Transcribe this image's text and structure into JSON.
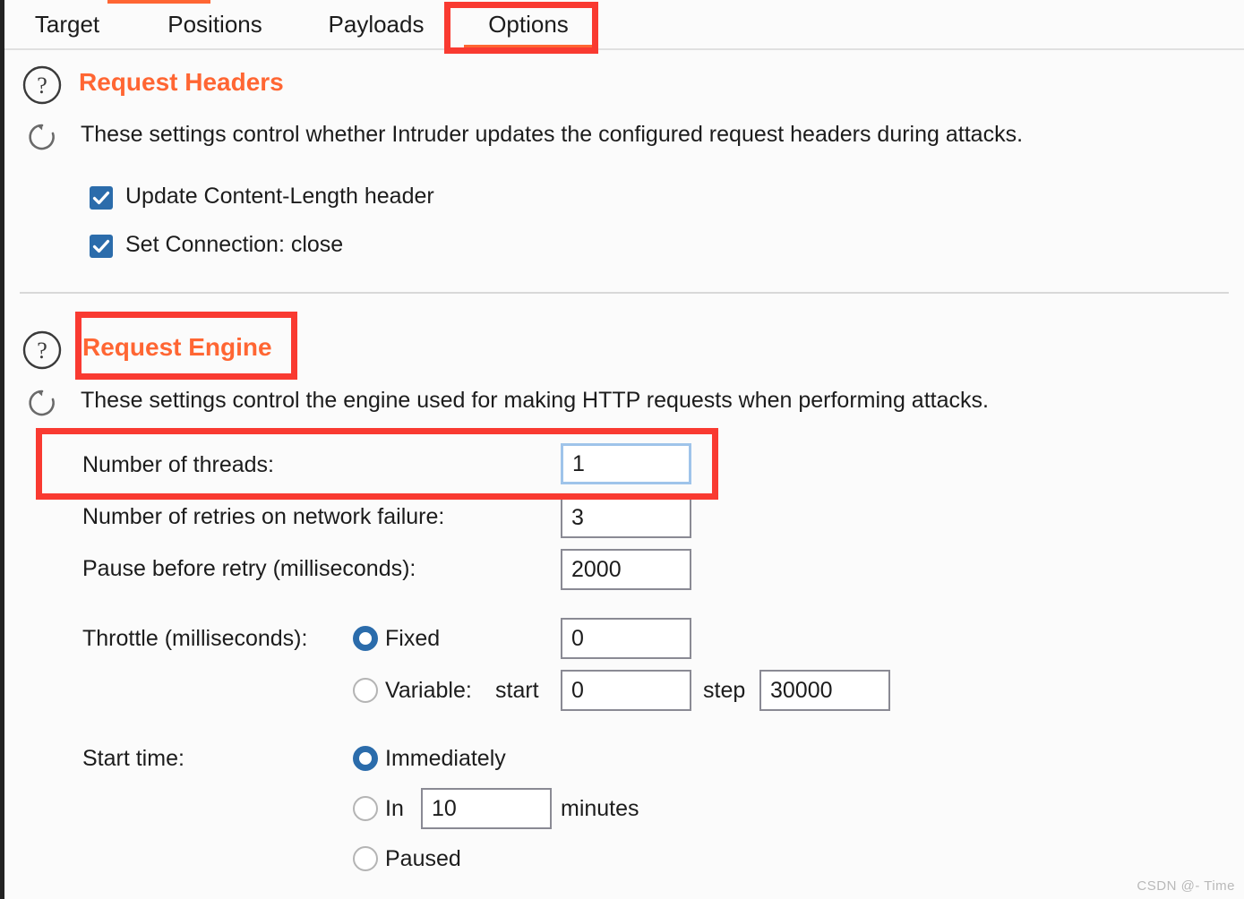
{
  "window": {
    "accent_orange": "#ff6633",
    "annotation_red": "#f93a31",
    "control_blue": "#2b6cab",
    "background": "#fbfbfb"
  },
  "tabs": [
    {
      "label": "Target",
      "active": false
    },
    {
      "label": "Positions",
      "active": false
    },
    {
      "label": "Payloads",
      "active": false
    },
    {
      "label": "Options",
      "active": true
    }
  ],
  "request_headers": {
    "title": "Request Headers",
    "description": "These settings control whether Intruder updates the configured request headers during attacks.",
    "help_icon": "question-circle-icon",
    "refresh_icon": "refresh-icon",
    "checkboxes": [
      {
        "label": "Update Content-Length header",
        "checked": true
      },
      {
        "label": "Set Connection: close",
        "checked": true
      }
    ]
  },
  "request_engine": {
    "title": "Request Engine",
    "description": "These settings control the engine used for making HTTP requests when performing attacks.",
    "help_icon": "question-circle-icon",
    "refresh_icon": "refresh-icon",
    "fields": {
      "threads_label": "Number of threads:",
      "threads_value": "1",
      "retries_label": "Number of retries on network failure:",
      "retries_value": "3",
      "pause_label": "Pause before retry (milliseconds):",
      "pause_value": "2000"
    },
    "throttle": {
      "label": "Throttle (milliseconds):",
      "fixed_label": "Fixed",
      "fixed_selected": true,
      "fixed_value": "0",
      "variable_label": "Variable:",
      "variable_selected": false,
      "start_label": "start",
      "start_value": "0",
      "step_label": "step",
      "step_value": "30000"
    },
    "start_time": {
      "label": "Start time:",
      "immediately_label": "Immediately",
      "immediately_selected": true,
      "in_label": "In",
      "in_selected": false,
      "in_value": "10",
      "minutes_label": "minutes",
      "paused_label": "Paused",
      "paused_selected": false
    }
  },
  "annotations": [
    {
      "name": "options-tab-highlight"
    },
    {
      "name": "request-engine-title-highlight"
    },
    {
      "name": "number-of-threads-highlight"
    }
  ],
  "watermark": "CSDN @- Time"
}
